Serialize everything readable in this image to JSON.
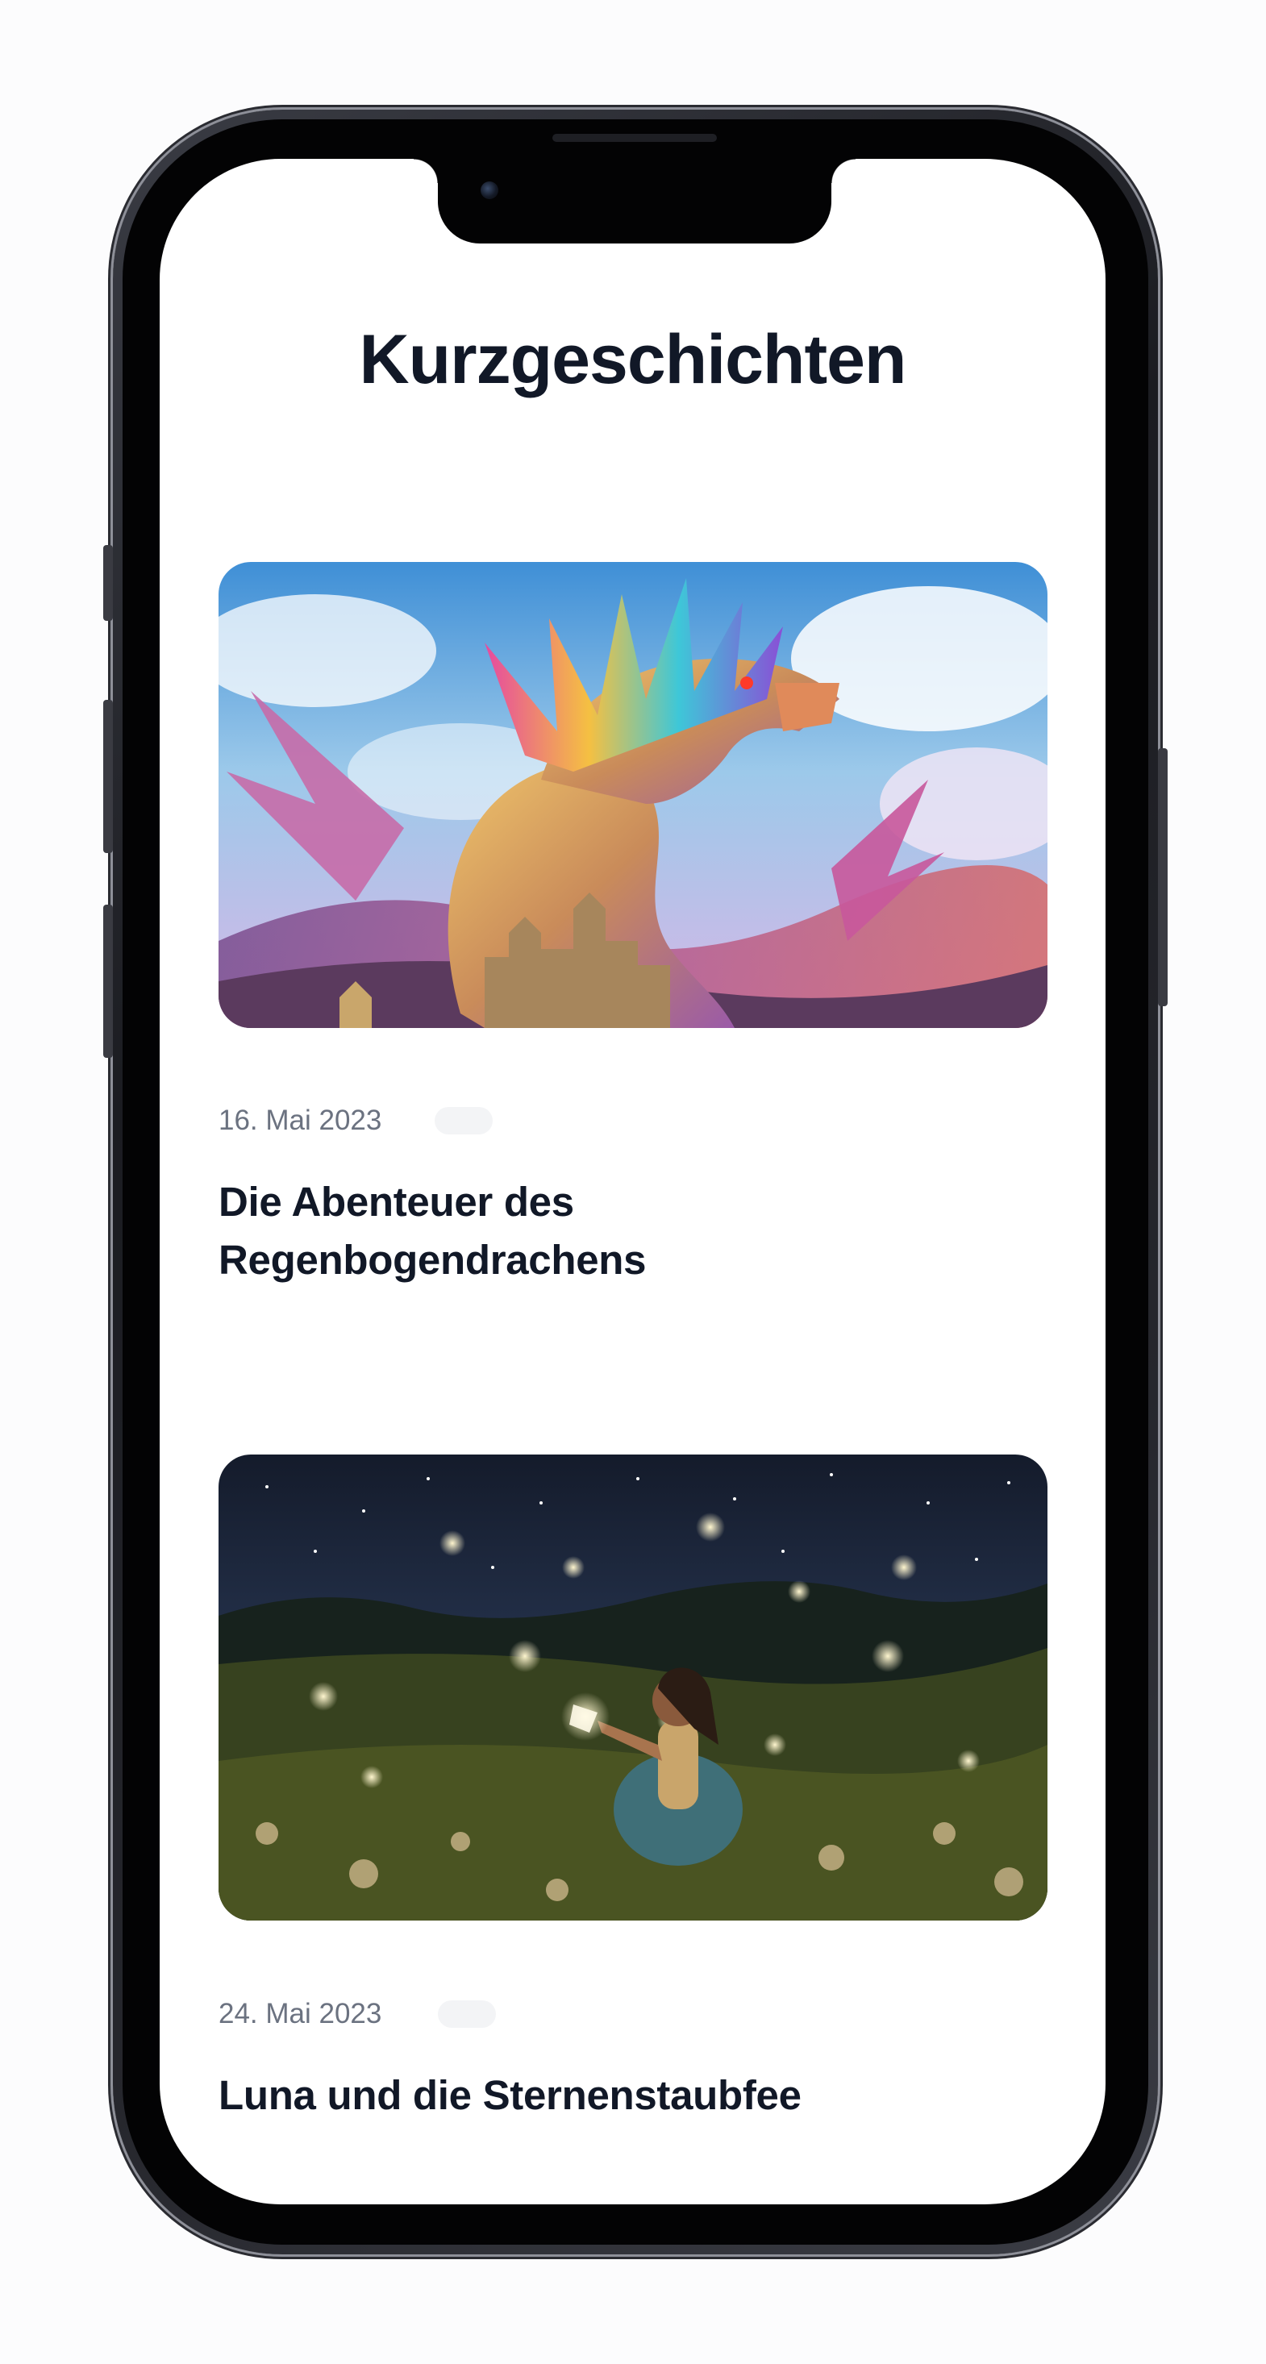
{
  "page": {
    "title": "Kurzgeschichten"
  },
  "stories": [
    {
      "date": "16. Mai 2023",
      "title": "Die Abenteuer des Regenbogendrachens",
      "image": "rainbow-dragon-illustration"
    },
    {
      "date": "24. Mai 2023",
      "title": "Luna und die Sternenstaubfee",
      "image": "girl-with-glowing-butterflies-illustration"
    }
  ],
  "colors": {
    "title": "#111827",
    "date": "#6b7280",
    "tag": "#f3f4f6",
    "background": "#ffffff"
  }
}
